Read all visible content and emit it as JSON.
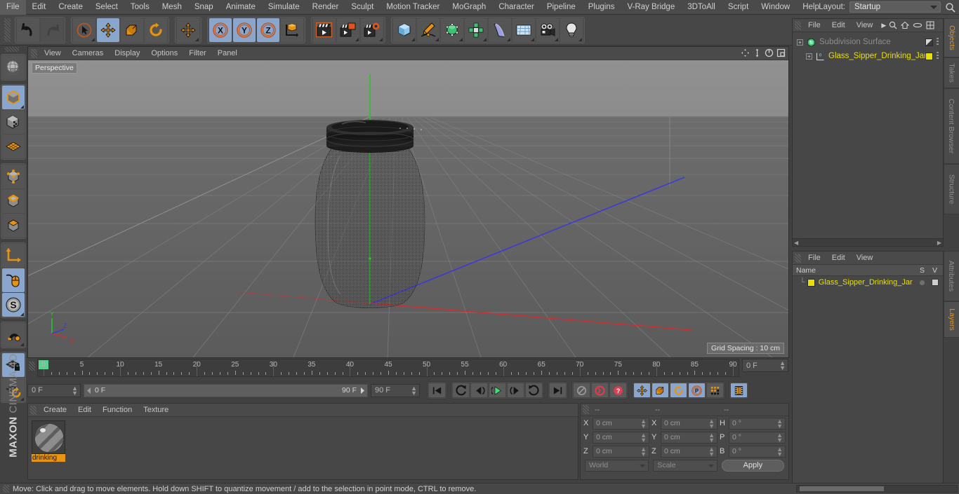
{
  "app": {
    "brand_maxon": "MAXON",
    "brand_c4d": "CINEMA 4D"
  },
  "menubar": {
    "items": [
      "File",
      "Edit",
      "Create",
      "Select",
      "Tools",
      "Mesh",
      "Snap",
      "Animate",
      "Simulate",
      "Render",
      "Sculpt",
      "Motion Tracker",
      "MoGraph",
      "Character",
      "Pipeline",
      "Plugins",
      "V-Ray Bridge",
      "3DToAll",
      "Script",
      "Window",
      "Help"
    ],
    "layout_label": "Layout:",
    "layout_value": "Startup",
    "search_icon": "search-icon"
  },
  "toolbar": {
    "groups": [
      {
        "name": "history",
        "buttons": [
          {
            "name": "undo-button",
            "icon": "undo-icon",
            "selected": false,
            "dim": false,
            "corner": false
          },
          {
            "name": "redo-button",
            "icon": "redo-icon",
            "selected": false,
            "dim": true,
            "corner": false
          }
        ]
      },
      {
        "name": "select-transform",
        "buttons": [
          {
            "name": "live-selection-button",
            "icon": "cursor-circle-icon",
            "selected": false,
            "dim": false,
            "corner": true
          },
          {
            "name": "move-tool-button",
            "icon": "move-icon",
            "selected": true,
            "dim": false,
            "corner": false
          },
          {
            "name": "scale-tool-button",
            "icon": "scale-icon",
            "selected": false,
            "dim": false,
            "corner": false
          },
          {
            "name": "rotate-tool-button",
            "icon": "rotate-icon",
            "selected": false,
            "dim": false,
            "corner": false
          }
        ]
      },
      {
        "name": "move-solo",
        "buttons": [
          {
            "name": "move-alt-button",
            "icon": "move-icon",
            "selected": false,
            "dim": false,
            "corner": true
          }
        ]
      },
      {
        "name": "axis-locks",
        "buttons": [
          {
            "name": "lock-x-button",
            "icon": "x-axis-icon",
            "selected": true,
            "dim": false,
            "corner": false
          },
          {
            "name": "lock-y-button",
            "icon": "y-axis-icon",
            "selected": true,
            "dim": false,
            "corner": false
          },
          {
            "name": "lock-z-button",
            "icon": "z-axis-icon",
            "selected": true,
            "dim": false,
            "corner": false
          },
          {
            "name": "world-object-axis-button",
            "icon": "axis-cube-icon",
            "selected": false,
            "dim": false,
            "corner": false
          }
        ]
      },
      {
        "name": "render",
        "buttons": [
          {
            "name": "render-view-button",
            "icon": "clapperboard-icon",
            "selected": false,
            "dim": false,
            "corner": false
          },
          {
            "name": "render-to-picture-viewer-button",
            "icon": "clapperboard-picture-icon",
            "selected": false,
            "dim": false,
            "corner": true
          },
          {
            "name": "render-settings-button",
            "icon": "clapperboard-gear-icon",
            "selected": false,
            "dim": false,
            "corner": true
          }
        ]
      },
      {
        "name": "create-objects",
        "buttons": [
          {
            "name": "add-cube-button",
            "icon": "cube-icon",
            "selected": false,
            "dim": false,
            "corner": true
          },
          {
            "name": "add-spline-button",
            "icon": "pen-spline-icon",
            "selected": false,
            "dim": false,
            "corner": true
          },
          {
            "name": "add-generator-button",
            "icon": "generator-cube-icon",
            "selected": false,
            "dim": false,
            "corner": true
          },
          {
            "name": "add-mograph-button",
            "icon": "mograph-cluster-icon",
            "selected": false,
            "dim": false,
            "corner": true
          },
          {
            "name": "add-deformer-button",
            "icon": "bend-deformer-icon",
            "selected": false,
            "dim": false,
            "corner": true
          },
          {
            "name": "add-floor-button",
            "icon": "floor-icon",
            "selected": false,
            "dim": false,
            "corner": true
          },
          {
            "name": "add-camera-button",
            "icon": "camera-icon",
            "selected": false,
            "dim": false,
            "corner": true
          },
          {
            "name": "add-light-button",
            "icon": "light-bulb-icon",
            "selected": false,
            "dim": false,
            "corner": true
          }
        ]
      }
    ]
  },
  "left_toolbar": {
    "groups": [
      {
        "buttons": [
          {
            "name": "texture-axis-button",
            "icon": "globe-grid-icon",
            "selected": false,
            "corner": false
          }
        ]
      },
      {
        "buttons": [
          {
            "name": "model-mode-button",
            "icon": "model-cube-icon",
            "selected": true,
            "corner": true
          },
          {
            "name": "texture-mode-button",
            "icon": "texture-cube-icon",
            "selected": false,
            "corner": false
          },
          {
            "name": "workplane-button",
            "icon": "workplane-grid-icon",
            "selected": false,
            "corner": false
          }
        ]
      },
      {
        "buttons": [
          {
            "name": "points-mode-button",
            "icon": "points-cube-icon",
            "selected": false,
            "corner": false
          },
          {
            "name": "edges-mode-button",
            "icon": "edges-cube-icon",
            "selected": false,
            "corner": false
          },
          {
            "name": "polygons-mode-button",
            "icon": "polygons-cube-icon",
            "selected": false,
            "corner": false
          }
        ]
      },
      {
        "buttons": [
          {
            "name": "object-axis-button",
            "icon": "axis-arrow-icon",
            "selected": false,
            "corner": false
          },
          {
            "name": "viewport-solo-button",
            "icon": "mouse-icon",
            "selected": true,
            "corner": false
          },
          {
            "name": "scale-snap-button",
            "icon": "s-circle-icon",
            "selected": true,
            "corner": true
          }
        ]
      },
      {
        "buttons": [
          {
            "name": "snap-magnet-button",
            "icon": "magnet-icon",
            "selected": false,
            "corner": true
          }
        ]
      },
      {
        "buttons": [
          {
            "name": "workplane-lock-button",
            "icon": "grid-lock-icon",
            "selected": true,
            "corner": false
          },
          {
            "name": "workplane-reset-button",
            "icon": "grid-reset-icon",
            "selected": false,
            "corner": true
          }
        ]
      }
    ]
  },
  "viewport": {
    "menu": [
      "View",
      "Cameras",
      "Display",
      "Options",
      "Filter",
      "Panel"
    ],
    "nav_icons": [
      "pan-icon",
      "dolly-icon",
      "rotate-icon",
      "maximize-icon"
    ],
    "label": "Perspective",
    "grid_spacing": "Grid Spacing : 10 cm",
    "axis_gizmo": {
      "y": "Y",
      "z": "Z",
      "x": "X"
    },
    "scene_object": "Glass_Sipper_Drinking_Jar"
  },
  "timeline": {
    "ticks": [
      "0",
      "5",
      "10",
      "15",
      "20",
      "25",
      "30",
      "35",
      "40",
      "45",
      "50",
      "55",
      "60",
      "65",
      "70",
      "75",
      "80",
      "85",
      "90"
    ],
    "tick_values": [
      0,
      5,
      10,
      15,
      20,
      25,
      30,
      35,
      40,
      45,
      50,
      55,
      60,
      65,
      70,
      75,
      80,
      85,
      90
    ],
    "current_frame_right": "0 F",
    "current_frame": "0 F",
    "range_start": "0 F",
    "range_end": "90 F",
    "end_frame": "90 F"
  },
  "transport": {
    "buttons": [
      {
        "name": "goto-start-button",
        "icon": "skip-start-icon",
        "selected": false
      },
      {
        "name": "previous-key-button",
        "icon": "prev-key-icon",
        "selected": false
      },
      {
        "name": "step-back-button",
        "icon": "step-back-icon",
        "selected": false
      },
      {
        "name": "play-button",
        "icon": "play-icon",
        "selected": false
      },
      {
        "name": "step-forward-button",
        "icon": "step-forward-icon",
        "selected": false
      },
      {
        "name": "next-key-button",
        "icon": "next-key-icon",
        "selected": false
      },
      {
        "name": "goto-end-button",
        "icon": "skip-end-icon",
        "selected": false
      },
      {
        "name": "record-active-objects-button",
        "icon": "key-icon",
        "selected": false
      },
      {
        "name": "autokeying-button",
        "icon": "record-circle-icon",
        "selected": false
      },
      {
        "name": "keyframe-help-button",
        "icon": "question-circle-icon",
        "selected": false
      },
      {
        "name": "position-key-button",
        "icon": "move-icon",
        "selected": true
      },
      {
        "name": "scale-key-button",
        "icon": "scale-icon",
        "selected": true
      },
      {
        "name": "rotation-key-button",
        "icon": "rotate-icon",
        "selected": true
      },
      {
        "name": "param-key-button",
        "icon": "p-circle-icon",
        "selected": true
      },
      {
        "name": "point-level-anim-button",
        "icon": "dots-grid-icon",
        "selected": false
      },
      {
        "name": "timeline-button",
        "icon": "film-strip-icon",
        "selected": true
      }
    ]
  },
  "material_manager": {
    "menu": [
      "Create",
      "Edit",
      "Function",
      "Texture"
    ],
    "materials": [
      {
        "name": "drinking"
      }
    ]
  },
  "coordinates": {
    "col_headers": [
      "--",
      "--",
      "--"
    ],
    "rows": [
      {
        "pos_label": "X",
        "pos_value": "0 cm",
        "size_label": "X",
        "size_value": "0 cm",
        "rot_label": "H",
        "rot_value": "0 °"
      },
      {
        "pos_label": "Y",
        "pos_value": "0 cm",
        "size_label": "Y",
        "size_value": "0 cm",
        "rot_label": "P",
        "rot_value": "0 °"
      },
      {
        "pos_label": "Z",
        "pos_value": "0 cm",
        "size_label": "Z",
        "size_value": "0 cm",
        "rot_label": "B",
        "rot_value": "0 °"
      }
    ],
    "world_select": "World",
    "scale_select": "Scale",
    "apply_label": "Apply"
  },
  "object_manager": {
    "menu": [
      "File",
      "Edit",
      "View"
    ],
    "icons": [
      "search-icon",
      "home-icon",
      "ellipse-icon",
      "frame-icon"
    ],
    "items": [
      {
        "name": "Subdivision Surface",
        "icon": "subdivision-icon",
        "color": "#8c8c8c",
        "indent": 0,
        "swatch": "checker"
      },
      {
        "name": "Glass_Sipper_Drinking_Jar",
        "icon": "polygon-object-icon",
        "color": "#e8e000",
        "indent": 1,
        "swatch": "yellow"
      }
    ]
  },
  "layer_manager": {
    "menu": [
      "File",
      "Edit",
      "View"
    ],
    "columns": [
      "Name",
      "S",
      "V"
    ],
    "items": [
      {
        "name": "Glass_Sipper_Drinking_Jar",
        "color": "#e8e000"
      }
    ]
  },
  "right_tabs_top": [
    {
      "label": "Objects",
      "active": true
    },
    {
      "label": "Takes",
      "active": false
    },
    {
      "label": "Content Browser",
      "active": false
    },
    {
      "label": "Structure",
      "active": false
    }
  ],
  "right_tabs_bottom": [
    {
      "label": "Attributes",
      "active": false
    },
    {
      "label": "Layers",
      "active": true
    }
  ],
  "status_bar": {
    "message": "Move: Click and drag to move elements. Hold down SHIFT to quantize movement / add to the selection in point mode, CTRL to remove."
  },
  "colors": {
    "accent_orange": "#e8950f",
    "selected_blue": "#8aa6cc",
    "panel_bg": "#474747",
    "yellow": "#e8e000"
  }
}
